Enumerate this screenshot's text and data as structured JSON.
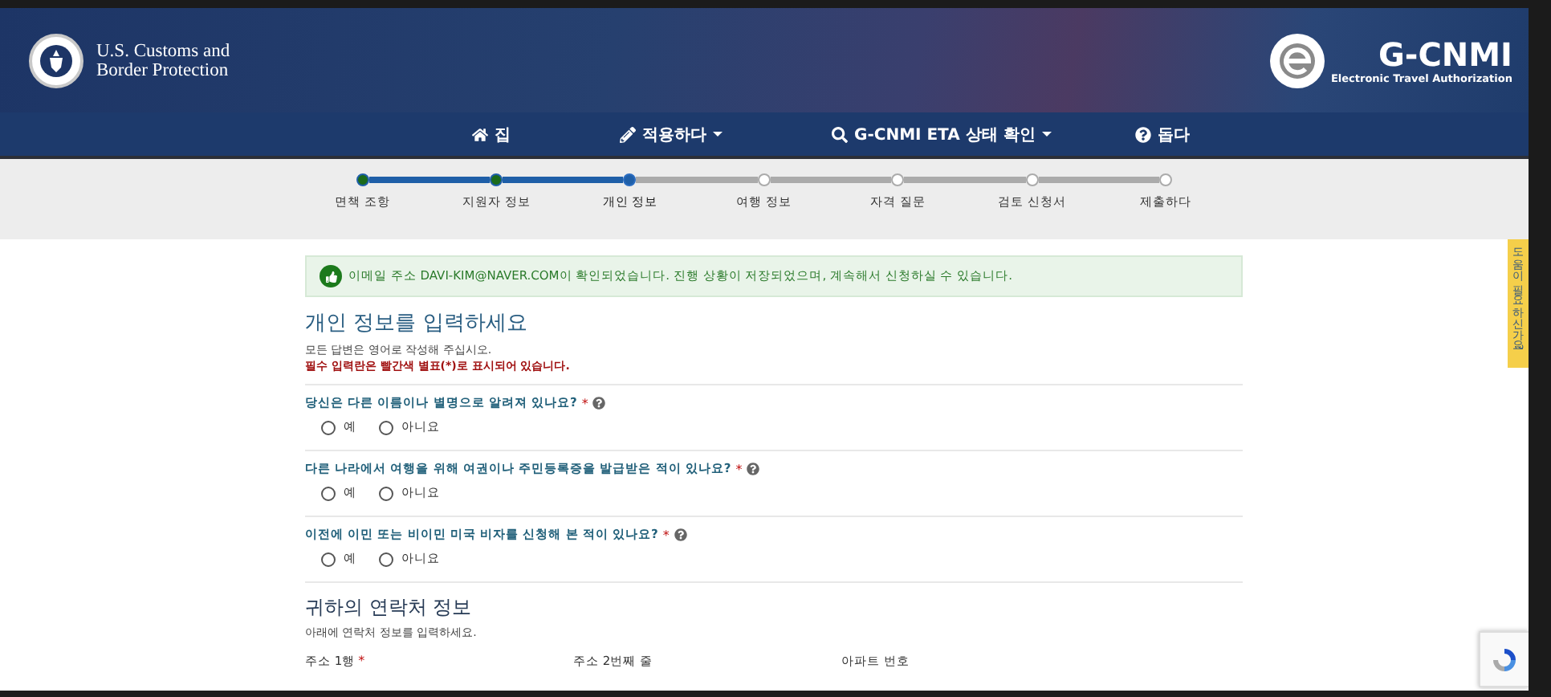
{
  "header": {
    "agency": "U.S. Customs and Border Protection",
    "brand": "G-CNMI",
    "brand_tagline": "Electronic Travel Authorization"
  },
  "nav": [
    {
      "label": "집",
      "dropdown": false
    },
    {
      "label": "적용하다",
      "dropdown": true
    },
    {
      "label": "G-CNMI ETA 상태 확인",
      "dropdown": true
    },
    {
      "label": "돕다",
      "dropdown": false
    }
  ],
  "steps": [
    {
      "label": "면책 조항",
      "completed": true,
      "selected": false
    },
    {
      "label": "지원자 정보",
      "completed": true,
      "selected": false
    },
    {
      "label": "개인 정보",
      "completed": false,
      "selected": true
    },
    {
      "label": "여행 정보",
      "completed": false,
      "selected": false
    },
    {
      "label": "자격 질문",
      "completed": false,
      "selected": false
    },
    {
      "label": "검토 신청서",
      "completed": false,
      "selected": false
    },
    {
      "label": "제출하다",
      "completed": false,
      "selected": false
    }
  ],
  "alert": {
    "text": "이메일 주소 DAVI-KIM@NAVER.COM이 확인되었습니다. 진행 상황이 저장되었으며, 계속해서 신청하실 수 있습니다."
  },
  "form": {
    "title": "개인 정보를 입력하세요",
    "note": "모든 답변은 영어로 작성해 주십시오.",
    "required_note": "필수 입력란은 빨간색 별표(*)로 표시되어 있습니다.",
    "questions": [
      {
        "label": "당신은 다른 이름이나 별명으로 알려져 있나요?",
        "required_mark": "*",
        "options": [
          {
            "label": "예",
            "checked": false
          },
          {
            "label": "아니요",
            "checked": false
          }
        ]
      },
      {
        "label": "다른 나라에서 여행을 위해 여권이나 주민등록증을 발급받은 적이 있나요?",
        "required_mark": "*",
        "options": [
          {
            "label": "예",
            "checked": false
          },
          {
            "label": "아니요",
            "checked": false
          }
        ]
      },
      {
        "label": "이전에 이민 또는 비이민 미국 비자를 신청해 본 적이 있나요?",
        "required_mark": "*",
        "options": [
          {
            "label": "예",
            "checked": false
          },
          {
            "label": "아니요",
            "checked": false
          }
        ]
      }
    ]
  },
  "contact": {
    "title": "귀하의 연락처 정보",
    "note": "아래에 연락처 정보를 입력하세요.",
    "fields": [
      {
        "label": "주소 1행",
        "required_mark": "*"
      },
      {
        "label": "주소 2번째 줄"
      },
      {
        "label": "아파트 번호"
      }
    ]
  },
  "side_tab": {
    "label": "도움이 필요하신가요?"
  }
}
